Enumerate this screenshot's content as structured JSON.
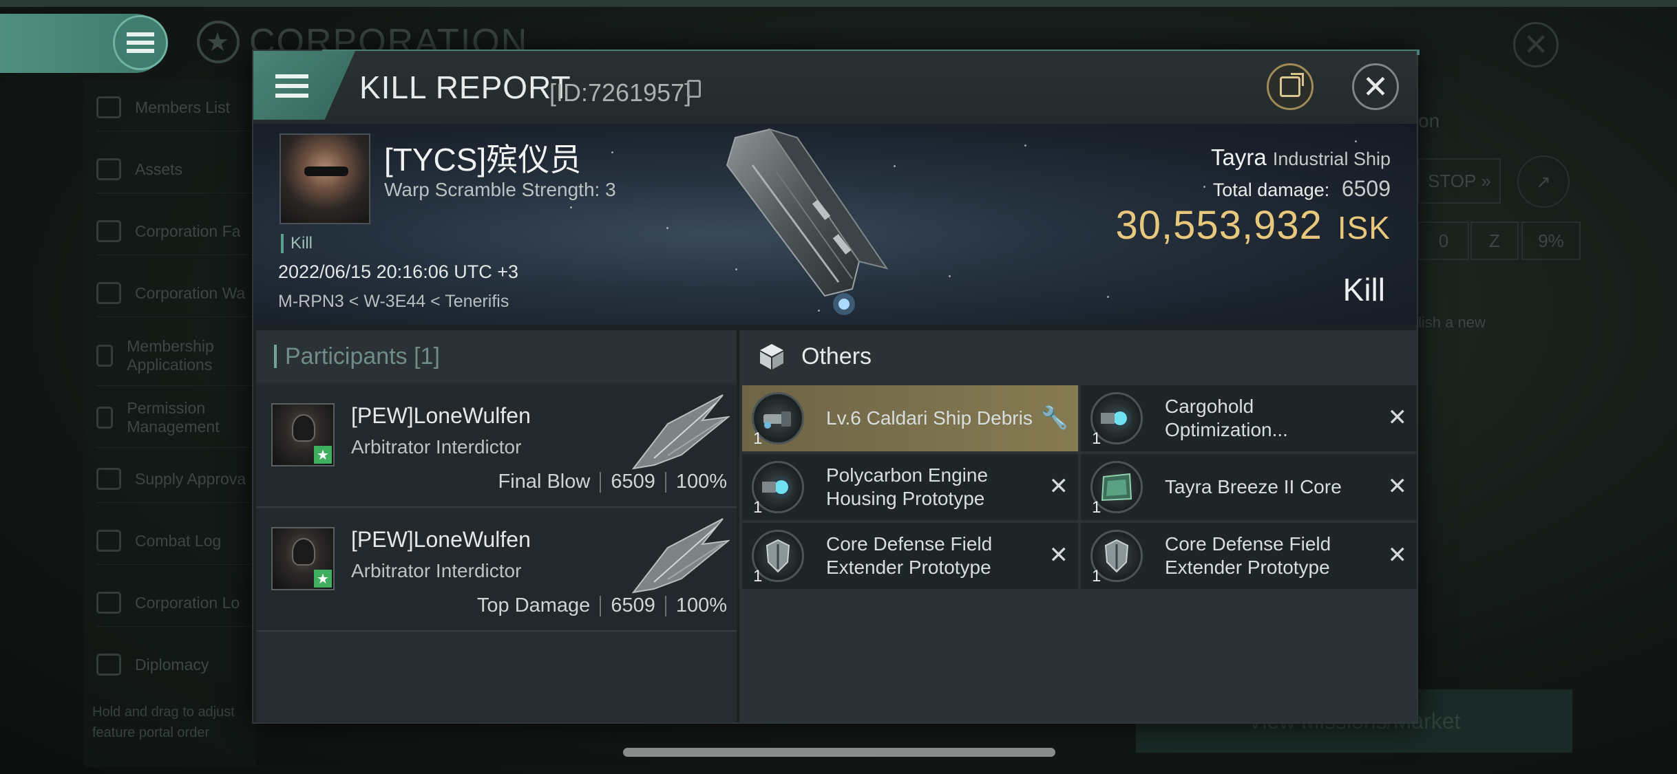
{
  "background": {
    "app_title": "CORPORATION",
    "sidebar_items": [
      {
        "label": "Members List"
      },
      {
        "label": "Assets"
      },
      {
        "label": "Corporation Fa"
      },
      {
        "label": "Corporation Wa"
      },
      {
        "label": "Membership Applications"
      },
      {
        "label": "Permission Management"
      },
      {
        "label": "Supply Approva"
      },
      {
        "label": "Combat Log"
      },
      {
        "label": "Corporation Lo"
      },
      {
        "label": "Diplomacy"
      }
    ],
    "hint": "Hold and drag to adjust feature portal order",
    "right_fragments": {
      "on": "on",
      "stop": "STOP",
      "zero": "0",
      "percent": "9%",
      "publish": "lish a new",
      "bottom_button": "View Missions/Market"
    }
  },
  "modal": {
    "title": "KILL REPORT",
    "report_id": "[ID:7261957]"
  },
  "kill": {
    "pilot_name": "[TYCS]殡仪员",
    "warp_scramble": "Warp Scramble Strength: 3",
    "tag": "Kill",
    "datetime": "2022/06/15 20:16:06 UTC +3",
    "location": "M-RPN3 < W-3E44 < Tenerifis",
    "ship_name": "Tayra",
    "ship_class": "Industrial Ship",
    "total_damage_label": "Total damage:",
    "total_damage": "6509",
    "isk_value": "30,553,932",
    "isk_unit": "ISK",
    "result": "Kill"
  },
  "participants": {
    "label": "Participants",
    "count": "[1]",
    "rows": [
      {
        "name": "[PEW]LoneWulfen",
        "ship": "Arbitrator Interdictor",
        "role": "Final Blow",
        "damage": "6509",
        "percent": "100%"
      },
      {
        "name": "[PEW]LoneWulfen",
        "ship": "Arbitrator Interdictor",
        "role": "Top Damage",
        "damage": "6509",
        "percent": "100%"
      }
    ]
  },
  "others": {
    "label": "Others",
    "items": [
      {
        "qty": "1",
        "name": "Lv.6 Caldari Ship Debris",
        "action_icon": "wrench-icon"
      },
      {
        "qty": "1",
        "name": "Cargohold Optimization...",
        "action_icon": "close-icon"
      },
      {
        "qty": "1",
        "name": "Polycarbon Engine Housing Prototype",
        "action_icon": "close-icon"
      },
      {
        "qty": "1",
        "name": "Tayra Breeze II Core",
        "action_icon": "close-icon"
      },
      {
        "qty": "1",
        "name": "Core Defense Field Extender Prototype",
        "action_icon": "close-icon"
      },
      {
        "qty": "1",
        "name": "Core Defense Field Extender Prototype",
        "action_icon": "close-icon"
      }
    ]
  },
  "colors": {
    "accent": "#4a8577",
    "isk": "#e8c87c",
    "highlight": "#857a52"
  }
}
